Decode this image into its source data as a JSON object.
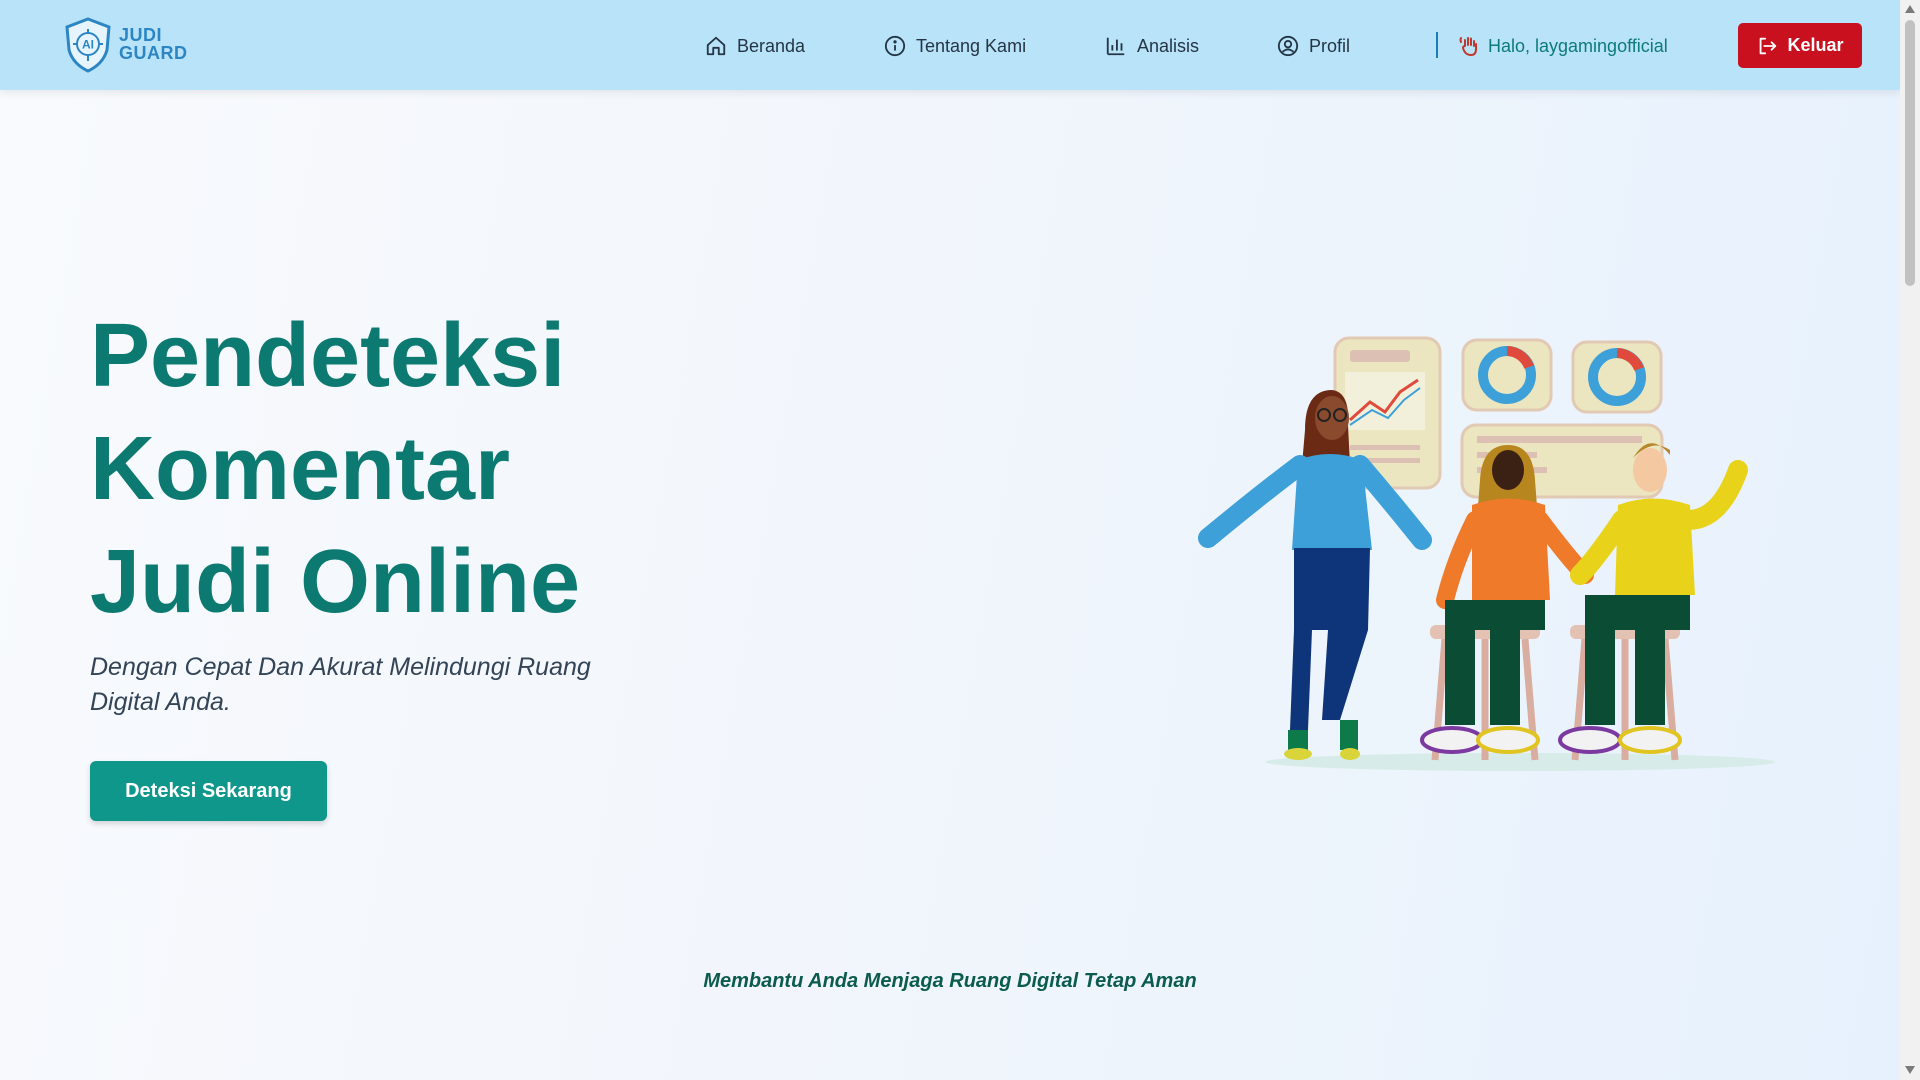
{
  "brand": {
    "logo_mark": "AI",
    "name_line1": "JUDI",
    "name_line2": "GUARD",
    "logo_icon": "shield-circuit-icon"
  },
  "nav": {
    "items": [
      {
        "label": "Beranda",
        "icon": "home-icon"
      },
      {
        "label": "Tentang Kami",
        "icon": "info-icon"
      },
      {
        "label": "Analisis",
        "icon": "bar-chart-icon"
      },
      {
        "label": "Profil",
        "icon": "user-circle-icon"
      }
    ],
    "greeting": "Halo, laygamingofficial",
    "greeting_icon": "waving-hand-icon",
    "logout_label": "Keluar",
    "logout_icon": "logout-icon"
  },
  "hero": {
    "title_lines": [
      "Pendeteksi",
      "Komentar",
      "Judi Online"
    ],
    "subtitle": "Dengan Cepat Dan Akurat Melindungi Ruang Digital Anda.",
    "cta_label": "Deteksi Sekarang"
  },
  "tagline": "Membantu Anda Menjaga Ruang Digital Tetap Aman",
  "colors": {
    "nav_bg": "#b9e3f9",
    "primary_teal": "#0d7a72",
    "cta_bg": "#0f978b",
    "logout_bg": "#c8101e",
    "brand_blue": "#2c86c4"
  }
}
